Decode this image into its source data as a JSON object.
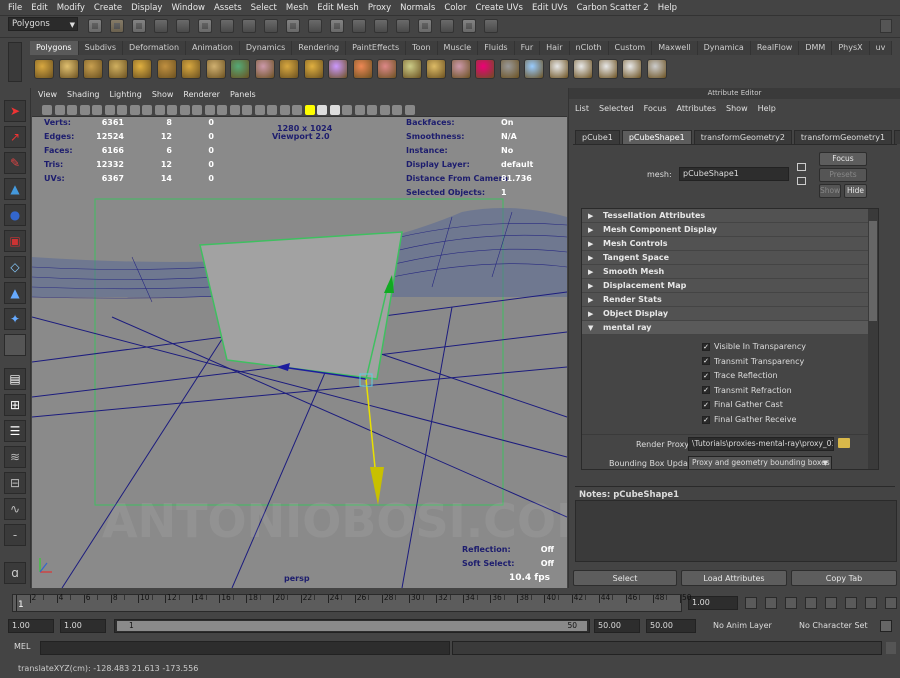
{
  "menubar": [
    "File",
    "Edit",
    "Modify",
    "Create",
    "Display",
    "Window",
    "Assets",
    "Select",
    "Mesh",
    "Edit Mesh",
    "Proxy",
    "Normals",
    "Color",
    "Create UVs",
    "Edit UVs",
    "Carbon Scatter 2",
    "Help"
  ],
  "status": {
    "mode": "Polygons"
  },
  "shelf_tabs": [
    "Polygons",
    "Subdivs",
    "Deformation",
    "Animation",
    "Dynamics",
    "Rendering",
    "PaintEffects",
    "Toon",
    "Muscle",
    "Fluids",
    "Fur",
    "Hair",
    "nCloth",
    "Custom",
    "Maxwell",
    "Dynamica",
    "RealFlow",
    "DMM",
    "PhysX",
    "uv"
  ],
  "viewport": {
    "menu": [
      "View",
      "Shading",
      "Lighting",
      "Show",
      "Renderer",
      "Panels"
    ],
    "hud_left": [
      {
        "label": "Verts:",
        "a": "6361",
        "b": "8",
        "c": "0"
      },
      {
        "label": "Edges:",
        "a": "12524",
        "b": "12",
        "c": "0"
      },
      {
        "label": "Faces:",
        "a": "6166",
        "b": "6",
        "c": "0"
      },
      {
        "label": "Tris:",
        "a": "12332",
        "b": "12",
        "c": "0"
      },
      {
        "label": "UVs:",
        "a": "6367",
        "b": "14",
        "c": "0"
      }
    ],
    "resolution": "1280 x 1024",
    "viewport_label": "Viewport 2.0",
    "hud_right": [
      {
        "label": "Backfaces:",
        "value": "On"
      },
      {
        "label": "Smoothness:",
        "value": "N/A"
      },
      {
        "label": "Instance:",
        "value": "No"
      },
      {
        "label": "Display Layer:",
        "value": "default"
      },
      {
        "label": "Distance From Camera:",
        "value": "81.736"
      },
      {
        "label": "Selected Objects:",
        "value": "1"
      }
    ],
    "reflection_label": "Reflection:",
    "reflection_value": "Off",
    "softselect_label": "Soft Select:",
    "softselect_value": "Off",
    "fps": "10.4 fps",
    "camera": "persp"
  },
  "attribute_editor": {
    "title": "Attribute Editor",
    "menu": [
      "List",
      "Selected",
      "Focus",
      "Attributes",
      "Show",
      "Help"
    ],
    "tabs": [
      "pCube1",
      "pCubeShape1",
      "transformGeometry2",
      "transformGeometry1",
      "po"
    ],
    "mesh_label": "mesh:",
    "mesh_value": "pCubeShape1",
    "focus": "Focus",
    "presets": "Presets",
    "show": "Show",
    "hide": "Hide",
    "sections": [
      "Tessellation Attributes",
      "Mesh Component Display",
      "Mesh Controls",
      "Tangent Space",
      "Smooth Mesh",
      "Displacement Map",
      "Render Stats",
      "Object Display",
      "mental ray"
    ],
    "checkboxes": [
      "Visible In Transparency",
      "Transmit Transparency",
      "Trace Reflection",
      "Transmit Refraction",
      "Final Gather Cast",
      "Final Gather Receive"
    ],
    "render_proxy_label": "Render Proxy",
    "render_proxy_value": "\\Tutorials\\proxies-mental-ray\\proxy_01.mi",
    "bbox_label": "Bounding Box Update",
    "bbox_value": "Proxy and geometry bounding boxes",
    "notes": "Notes:  pCubeShape1",
    "buttons": [
      "Select",
      "Load Attributes",
      "Copy Tab"
    ]
  },
  "timeline": {
    "ticks": [
      "1",
      "2",
      "4",
      "6",
      "8",
      "10",
      "12",
      "14",
      "16",
      "18",
      "20",
      "22",
      "24",
      "26",
      "28",
      "30",
      "32",
      "34",
      "36",
      "38",
      "40",
      "42",
      "44",
      "46",
      "48",
      "50"
    ],
    "current": "1.00"
  },
  "range": {
    "start": "1.00",
    "inner_start": "1.00",
    "inner_min": "1",
    "inner_max": "50",
    "end": "50.00",
    "outer_end": "50.00",
    "anim_layer": "No Anim Layer",
    "character_set": "No Character Set"
  },
  "cmd": {
    "label": "MEL"
  },
  "help": {
    "text": "translateXYZ(cm):   -128.483    21.613    -173.556"
  },
  "watermark": "ANTONIOBOSI.COM",
  "colors": {
    "accent": "#5285a6",
    "selection_green": "#3fbf60",
    "grid_blue": "#1c1c7e",
    "move_yellow": "#e8e000"
  }
}
